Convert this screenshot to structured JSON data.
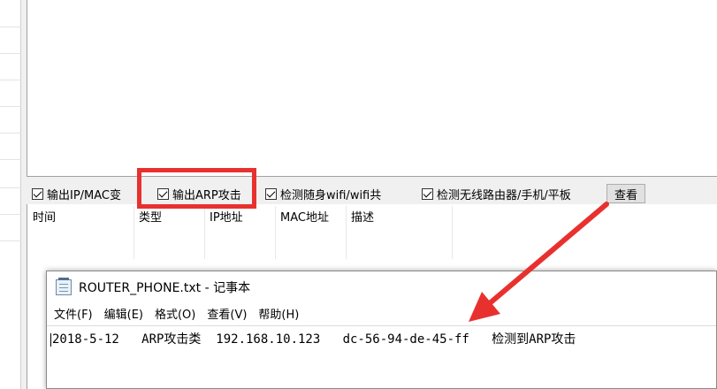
{
  "toolbar": {
    "checkboxes": [
      {
        "label": "输出IP/MAC变",
        "checked": true
      },
      {
        "label": "输出ARP攻击",
        "checked": true
      },
      {
        "label": "检测随身wifi/wifi共",
        "checked": true
      },
      {
        "label": "检测无线路由器/手机/平板",
        "checked": true
      }
    ],
    "view_button": "查看"
  },
  "list": {
    "columns": [
      "时间",
      "类型",
      "IP地址",
      "MAC地址",
      "描述"
    ]
  },
  "notepad": {
    "title": "ROUTER_PHONE.txt - 记事本",
    "menu": [
      "文件(F)",
      "编辑(E)",
      "格式(O)",
      "查看(V)",
      "帮助(H)"
    ],
    "content": "2018-5-12   ARP攻击类  192.168.10.123   dc-56-94-de-45-ff   检测到ARP攻击"
  },
  "colors": {
    "highlight": "#e8312f",
    "window_bg": "#f0f0f0"
  },
  "icons": {
    "notepad": "notepad-icon",
    "checkbox": "checkmark-icon"
  }
}
